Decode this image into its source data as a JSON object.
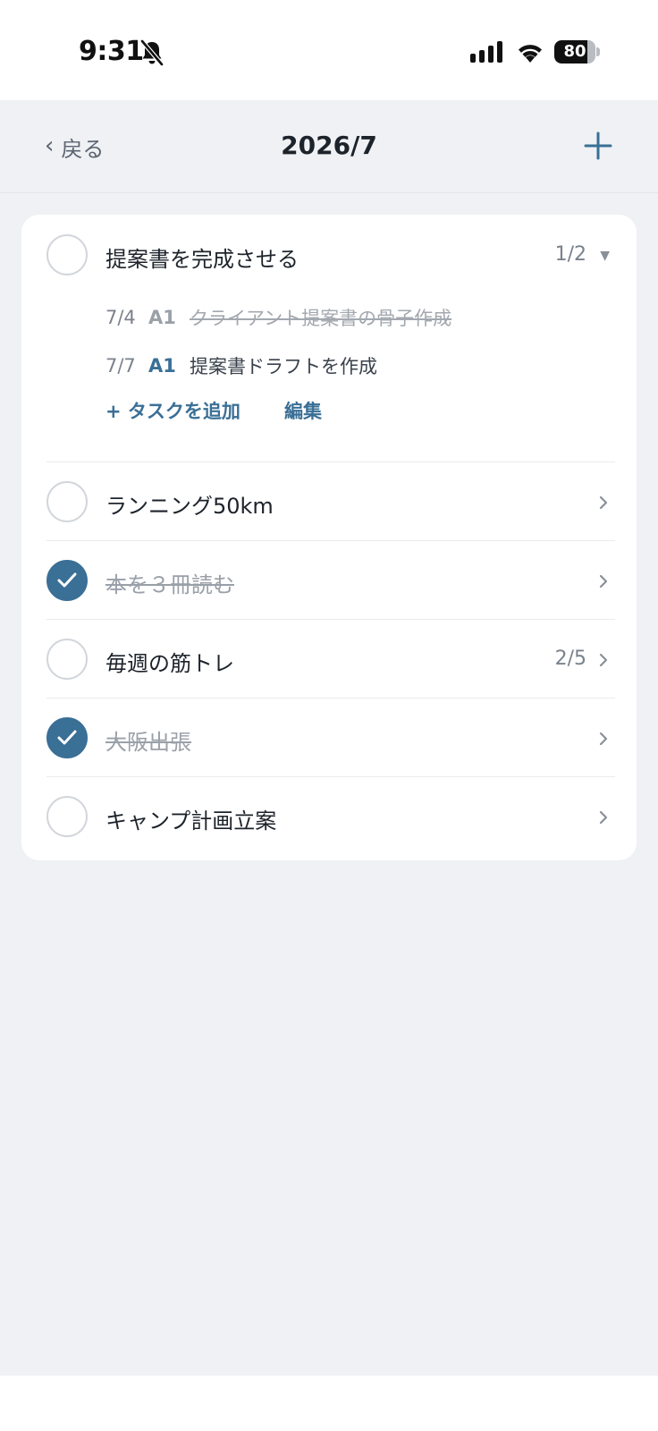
{
  "status": {
    "time": "9:31",
    "battery": "80",
    "battery_level": 0.8
  },
  "nav": {
    "back_label": "戻る",
    "title": "2026/7"
  },
  "goals": [
    {
      "title": "提案書を完成させる",
      "done": false,
      "count": "1/2",
      "expanded": true,
      "tasks": [
        {
          "date": "7/4",
          "tag": "A1",
          "text": "クライアント提案書の骨子作成",
          "done": true
        },
        {
          "date": "7/7",
          "tag": "A1",
          "text": "提案書ドラフトを作成",
          "done": false
        }
      ],
      "add_task_label": "+ タスクを追加",
      "edit_label": "編集"
    },
    {
      "title": "ランニング50km",
      "done": false,
      "count": ""
    },
    {
      "title": "本を３冊読む",
      "done": true,
      "count": ""
    },
    {
      "title": "毎週の筋トレ",
      "done": false,
      "count": "2/5"
    },
    {
      "title": "大阪出張",
      "done": true,
      "count": ""
    },
    {
      "title": "キャンプ計画立案",
      "done": false,
      "count": ""
    }
  ],
  "colors": {
    "accent": "#3a6f96",
    "background": "#eff1f4",
    "card": "#ffffff"
  },
  "icons": {
    "bell": "bell-slash-icon",
    "signal": "cellular-signal-icon",
    "wifi": "wifi-icon",
    "back": "chevron-left-icon",
    "add": "plus-icon",
    "chevron": "chevron-right-icon",
    "caret": "caret-down-icon",
    "check": "checkmark-icon"
  }
}
